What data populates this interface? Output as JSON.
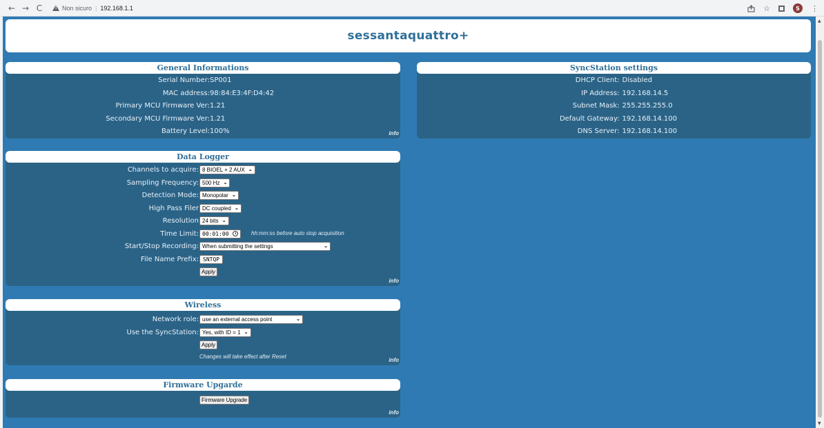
{
  "browser": {
    "back_glyph": "←",
    "forward_glyph": "→",
    "reload_glyph": "C",
    "security_text": "Non sicuro",
    "url": "192.168.1.1",
    "profile_initial": "S",
    "icons": [
      "back-icon",
      "forward-icon",
      "reload-icon",
      "warning-icon",
      "share-icon",
      "star-icon",
      "sidebar-icon",
      "profile-avatar",
      "menu-icon"
    ]
  },
  "page": {
    "title": "sessantaquattro+",
    "colors": {
      "page_bg": "#2f7ab2",
      "panel_bg": "#2b6387",
      "heading": "#2f6f99"
    },
    "info_label": "info"
  },
  "general": {
    "heading": "General Informations",
    "rows": [
      {
        "label": "Serial Number:",
        "value": "SP001"
      },
      {
        "label": "MAC address:",
        "value": "98:84:E3:4F:D4:42"
      },
      {
        "label": "Primary MCU Firmware Ver:",
        "value": "1.21"
      },
      {
        "label": "Secondary MCU Firmware Ver:",
        "value": "1.21"
      },
      {
        "label": "Battery Level:",
        "value": "100%"
      }
    ]
  },
  "syncstation": {
    "heading": "SyncStation settings",
    "rows": [
      {
        "label": "DHCP Client:",
        "value": "Disabled"
      },
      {
        "label": "IP Address:",
        "value": "192.168.14.5"
      },
      {
        "label": "Subnet Mask:",
        "value": "255.255.255.0"
      },
      {
        "label": "Default Gateway:",
        "value": "192.168.14.100"
      },
      {
        "label": "DNS Server:",
        "value": "192.168.14.100"
      }
    ]
  },
  "logger": {
    "heading": "Data Logger",
    "channels_label": "Channels to acquire:",
    "channels_value": "8 BIOEL + 2 AUX",
    "sampling_label": "Sampling Frequency:",
    "sampling_value": "500 Hz",
    "detection_label": "Detection Mode:",
    "detection_value": "Monopolar",
    "highpass_label": "High Pass Filer",
    "highpass_value": "DC coupled",
    "resolution_label": "Resolution",
    "resolution_value": "24 bits",
    "time_label": "Time Limit:",
    "time_value": "00:01:00",
    "time_hint": "hh:mm:ss before auto stop acquisition",
    "startstop_label": "Start/Stop Recording:",
    "startstop_value": "When submitting the settings",
    "prefix_label": "File Name Prefix:",
    "prefix_value": "SNTQP",
    "apply_label": "Apply"
  },
  "wireless": {
    "heading": "Wireless",
    "role_label": "Network role:",
    "role_value": "use an external access point",
    "sync_label": "Use the SyncStation:",
    "sync_value": "Yes, with ID = 1",
    "apply_label": "Apply",
    "note": "Changes will take effect after Reset"
  },
  "firmware": {
    "heading": "Firmware Upgarde",
    "button_label": "Firmware Upgrade"
  }
}
